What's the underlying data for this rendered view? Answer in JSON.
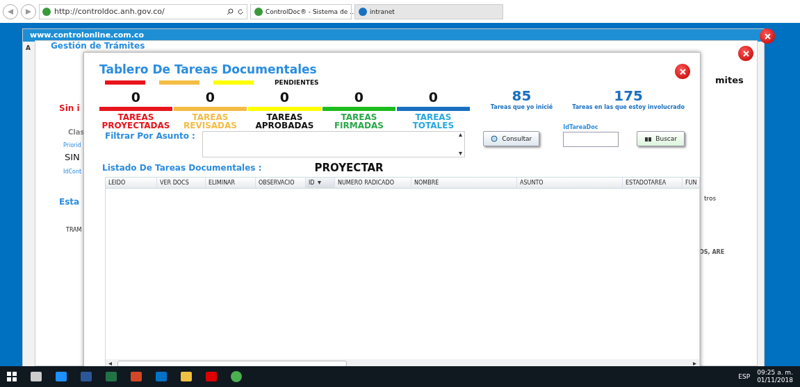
{
  "browser": {
    "address": "http://controldoc.anh.gov.co/",
    "tabs": [
      {
        "label": "ControlDoc® - Sistema de ...",
        "selected": true
      },
      {
        "label": "intranet",
        "selected": false
      }
    ]
  },
  "background_window": {
    "site": "www.controlonline.com.co",
    "tab_letter": "A",
    "title": "Gestión de Trámites",
    "fragments": {
      "heading_end": "mites",
      "status": "Sin i",
      "class_field": "Clas",
      "priority_label": "Priorid",
      "priority_value": "SIN",
      "id_label": "IdCont",
      "section": "Esta",
      "column": "TRAM",
      "button_end": "tros",
      "cell": "OS, ARE"
    }
  },
  "modal": {
    "title": "Tablero De Tareas Documentales",
    "legend": {
      "bars": [
        {
          "color": "#e8141c"
        },
        {
          "color": "#f4bc44"
        },
        {
          "color": "#ffff00"
        }
      ],
      "label": "PENDIENTES"
    },
    "stats": [
      {
        "value": "0",
        "bar": {
          "color": "#e8141c"
        },
        "label": {
          "text": "TAREAS\nPROYECTADAS",
          "color": "#e8141c"
        }
      },
      {
        "value": "0",
        "bar": {
          "color": "#f4bc44"
        },
        "label": {
          "text": "TAREAS\nREVISADAS",
          "color": "#f4bc44"
        }
      },
      {
        "value": "0",
        "bar": {
          "color": "#ffff00"
        },
        "label": {
          "text": "TAREAS\nAPROBADAS",
          "color": "#111111"
        }
      },
      {
        "value": "0",
        "bar": {
          "color": "#1dbb1d"
        },
        "label": {
          "text": "TAREAS\nFIRMADAS",
          "color": "#2aa84a"
        }
      },
      {
        "value": "0",
        "bar": {
          "color": "#1a70c0"
        },
        "label": {
          "text": "TAREAS\nTOTALES",
          "color": "#29a8e0"
        }
      }
    ],
    "counters": [
      {
        "value": "85",
        "label": "Tareas que yo inicié"
      },
      {
        "value": "175",
        "label": "Tareas en las que estoy involucrado"
      }
    ],
    "filter_label": "Filtrar Por Asunto :",
    "consult_button": "Consultar",
    "id_label": "IdTareaDoc",
    "search_button": "Buscar",
    "list_title": "Listado De Tareas Documentales :",
    "mode": "PROYECTAR",
    "columns": [
      {
        "label": "LEIDO",
        "sorted": false
      },
      {
        "label": "VER DOCS",
        "sorted": false
      },
      {
        "label": "ELIMINAR",
        "sorted": false
      },
      {
        "label": "OBSERVACIO",
        "sorted": false
      },
      {
        "label": "ID",
        "sorted": true
      },
      {
        "label": "NUMERO RADICADO",
        "sorted": false
      },
      {
        "label": "NOMBRE",
        "sorted": false
      },
      {
        "label": "ASUNTO",
        "sorted": false
      },
      {
        "label": "ESTADOTAREA",
        "sorted": false
      },
      {
        "label": "FUN",
        "sorted": false
      }
    ]
  },
  "taskbar": {
    "language": "ESP",
    "time": "09:25 a. m.",
    "date": "01/11/2018"
  }
}
